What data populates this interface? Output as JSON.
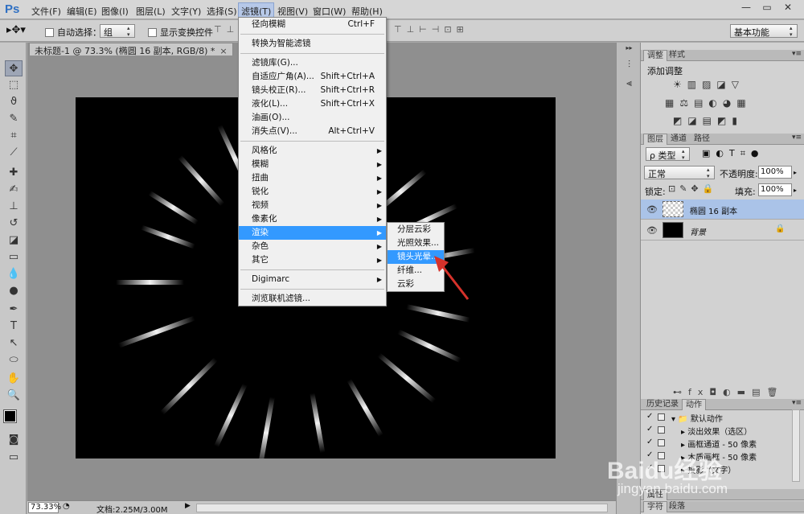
{
  "app": {
    "logo": "Ps"
  },
  "menubar": {
    "items": [
      "文件(F)",
      "编辑(E)",
      "图像(I)",
      "图层(L)",
      "文字(Y)",
      "选择(S)",
      "滤镜(T)",
      "视图(V)",
      "窗口(W)",
      "帮助(H)"
    ],
    "active": "滤镜(T)",
    "window_buttons": [
      "—",
      "▭",
      "✕"
    ]
  },
  "options_bar": {
    "auto_select_label": "自动选择：",
    "auto_select_value": "组",
    "show_transform_label": "显示变换控件",
    "align_icons": "⊤⊥⊢⊣⊡⊞",
    "workspace": "基本功能"
  },
  "document": {
    "tab_title": "未标题-1 @ 73.3% (椭圆 16 副本, RGB/8) *",
    "tab_close": "×",
    "zoom": "73.33%",
    "doc_info": "文档:2.25M/3.00M",
    "status_arrow": "▶"
  },
  "filter_menu": {
    "groups": [
      [
        {
          "label": "径向模糊",
          "shortcut": "Ctrl+F"
        }
      ],
      [
        {
          "label": "转换为智能滤镜"
        }
      ],
      [
        {
          "label": "滤镜库(G)..."
        },
        {
          "label": "自适应广角(A)...",
          "shortcut": "Shift+Ctrl+A"
        },
        {
          "label": "镜头校正(R)...",
          "shortcut": "Shift+Ctrl+R"
        },
        {
          "label": "液化(L)...",
          "shortcut": "Shift+Ctrl+X"
        },
        {
          "label": "油画(O)..."
        },
        {
          "label": "消失点(V)...",
          "shortcut": "Alt+Ctrl+V"
        }
      ],
      [
        {
          "label": "风格化",
          "submenu": true
        },
        {
          "label": "模糊",
          "submenu": true
        },
        {
          "label": "扭曲",
          "submenu": true
        },
        {
          "label": "锐化",
          "submenu": true
        },
        {
          "label": "视频",
          "submenu": true
        },
        {
          "label": "像素化",
          "submenu": true
        },
        {
          "label": "渲染",
          "submenu": true,
          "highlighted": true
        },
        {
          "label": "杂色",
          "submenu": true
        },
        {
          "label": "其它",
          "submenu": true
        }
      ],
      [
        {
          "label": "Digimarc",
          "submenu": true
        }
      ],
      [
        {
          "label": "浏览联机滤镜..."
        }
      ]
    ]
  },
  "render_submenu": {
    "items": [
      {
        "label": "分层云彩"
      },
      {
        "label": "光照效果..."
      },
      {
        "label": "镜头光晕...",
        "highlighted": true
      },
      {
        "label": "纤维..."
      },
      {
        "label": "云彩"
      }
    ]
  },
  "adjustments_panel": {
    "tabs": [
      "调整",
      "样式"
    ],
    "title": "添加调整",
    "row1": "☀▥▨◪▽",
    "row2": "▦⚖▤◐◕▦",
    "row3": "◩◪▤◩▮"
  },
  "layers_panel": {
    "tabs": [
      "图层",
      "通道",
      "路径"
    ],
    "kind_label": "ρ 类型",
    "kind_icons": "▣◐T⌗●",
    "blend_mode": "正常",
    "opacity_label": "不透明度:",
    "opacity_value": "100%",
    "lock_label": "锁定:",
    "lock_icons": "⊡✎✥🔒",
    "fill_label": "填充:",
    "fill_value": "100%",
    "layers": [
      {
        "name": "椭圆 16 副本",
        "selected": true,
        "italic": false,
        "locked": false,
        "eye": "👁",
        "lock_icon": ""
      },
      {
        "name": "背景",
        "selected": false,
        "italic": true,
        "locked": true,
        "eye": "👁",
        "lock_icon": "🔒"
      }
    ],
    "bottom_icons": "⊷fx◘◐▬▤🗑"
  },
  "history_actions_panel": {
    "tabs": [
      "历史记录",
      "动作"
    ],
    "rows": [
      {
        "check": "✓",
        "indent": 0,
        "text": "▾ 📁 默认动作"
      },
      {
        "check": "✓",
        "indent": 1,
        "text": "▸ 淡出效果（选区）"
      },
      {
        "check": "✓",
        "indent": 1,
        "text": "▸ 画框通道 - 50 像素"
      },
      {
        "check": "✓",
        "indent": 1,
        "text": "▸ 木质画框 - 50 像素"
      },
      {
        "check": "✓",
        "indent": 1,
        "text": "▸ 投影（文字）"
      }
    ]
  },
  "bottom_tabs": {
    "properties": "属性",
    "character_tabs": [
      "字符",
      "段落"
    ]
  },
  "toolbox": {
    "tools": [
      "move-tool",
      "marquee-tool",
      "lasso-tool",
      "quick-select-tool",
      "crop-tool",
      "eyedropper-tool",
      "healing-tool",
      "brush-tool",
      "stamp-tool",
      "history-brush-tool",
      "eraser-tool",
      "gradient-tool",
      "blur-tool",
      "dodge-tool",
      "pen-tool",
      "type-tool",
      "path-select-tool",
      "shape-tool",
      "hand-tool",
      "zoom-tool"
    ],
    "glyphs": [
      "✥",
      "⬚",
      "ϑ",
      "✎",
      "⌗",
      "⟋",
      "✚",
      "✍",
      "⊥",
      "↺",
      "◪",
      "▭",
      "💧",
      "●",
      "✒",
      "T",
      "↖",
      "⬭",
      "✋",
      "🔍"
    ],
    "selected": "move-tool"
  },
  "watermark": {
    "logo": "Baidu经验",
    "url": "jingyan.baidu.com"
  },
  "colors": {
    "highlight": "#3399ff",
    "layer_selected": "#aac3e8",
    "canvas": "#000000"
  }
}
